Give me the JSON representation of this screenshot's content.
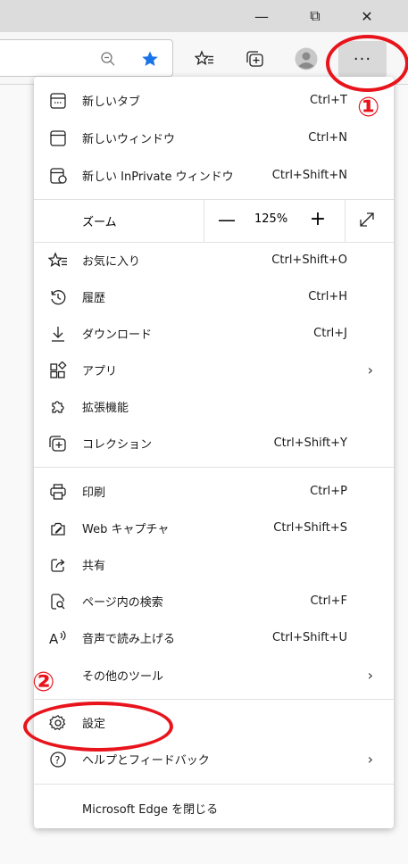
{
  "window": {
    "minimize_glyph": "—",
    "restore_glyph": "⧉",
    "close_glyph": "✕"
  },
  "toolbar": {
    "more_label": "···"
  },
  "menu": {
    "items_top": [
      {
        "label": "新しいタブ",
        "shortcut": "Ctrl+T",
        "icon": "new-tab-icon"
      },
      {
        "label": "新しいウィンドウ",
        "shortcut": "Ctrl+N",
        "icon": "new-window-icon"
      },
      {
        "label": "新しい InPrivate ウィンドウ",
        "shortcut": "Ctrl+Shift+N",
        "icon": "inprivate-icon"
      }
    ],
    "zoom": {
      "label": "ズーム",
      "value": "125%",
      "minus": "—",
      "plus": "+"
    },
    "items_mid": [
      {
        "label": "お気に入り",
        "shortcut": "Ctrl+Shift+O",
        "icon": "favorites-icon"
      },
      {
        "label": "履歴",
        "shortcut": "Ctrl+H",
        "icon": "history-icon"
      },
      {
        "label": "ダウンロード",
        "shortcut": "Ctrl+J",
        "icon": "download-icon"
      },
      {
        "label": "アプリ",
        "shortcut": "",
        "icon": "apps-icon",
        "submenu": true
      },
      {
        "label": "拡張機能",
        "shortcut": "",
        "icon": "extensions-icon"
      },
      {
        "label": "コレクション",
        "shortcut": "Ctrl+Shift+Y",
        "icon": "collections-icon"
      }
    ],
    "items_low": [
      {
        "label": "印刷",
        "shortcut": "Ctrl+P",
        "icon": "print-icon"
      },
      {
        "label": "Web キャプチャ",
        "shortcut": "Ctrl+Shift+S",
        "icon": "web-capture-icon"
      },
      {
        "label": "共有",
        "shortcut": "",
        "icon": "share-icon"
      },
      {
        "label": "ページ内の検索",
        "shortcut": "Ctrl+F",
        "icon": "find-icon"
      },
      {
        "label": "音声で読み上げる",
        "shortcut": "Ctrl+Shift+U",
        "icon": "read-aloud-icon"
      },
      {
        "label": "その他のツール",
        "shortcut": "",
        "icon": "",
        "submenu": true
      }
    ],
    "items_bottom": [
      {
        "label": "設定",
        "shortcut": "",
        "icon": "settings-icon"
      },
      {
        "label": "ヘルプとフィードバック",
        "shortcut": "",
        "icon": "help-icon",
        "submenu": true
      }
    ],
    "close_edge": "Microsoft Edge を閉じる"
  },
  "annotations": {
    "step1": "①",
    "step2": "②",
    "accent": "#e8141c"
  }
}
